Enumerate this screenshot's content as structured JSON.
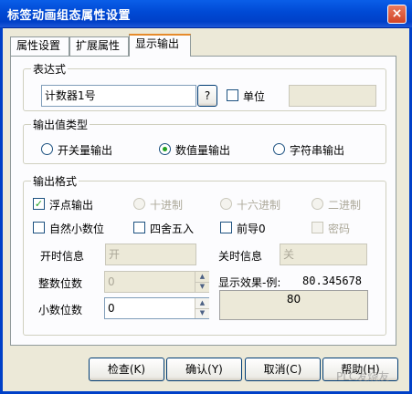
{
  "window": {
    "title": "标签动画组态属性设置",
    "close_label": "×"
  },
  "tabs": [
    {
      "label": "属性设置",
      "active": false
    },
    {
      "label": "扩展属性",
      "active": false
    },
    {
      "label": "显示输出",
      "active": true
    }
  ],
  "expression": {
    "group_label": "表达式",
    "value": "计数器1号",
    "help_button": "?",
    "unit_label": "单位",
    "unit_checked": false,
    "unit_value": ""
  },
  "output_type": {
    "group_label": "输出值类型",
    "options": [
      "开关量输出",
      "数值量输出",
      "字符串输出"
    ],
    "selected": "数值量输出"
  },
  "output_format": {
    "group_label": "输出格式",
    "float_output": {
      "label": "浮点输出",
      "checked": true
    },
    "decimal": {
      "label": "十进制"
    },
    "hex": {
      "label": "十六进制"
    },
    "binary": {
      "label": "二进制"
    },
    "natural_decimal": {
      "label": "自然小数位",
      "checked": false
    },
    "round": {
      "label": "四舍五入",
      "checked": false
    },
    "leading_zero": {
      "label": "前导0",
      "checked": false
    },
    "password": {
      "label": "密码",
      "checked": false
    },
    "on_info_label": "开时信息",
    "on_info_value": "开",
    "off_info_label": "关时信息",
    "off_info_value": "关",
    "integer_digits_label": "整数位数",
    "integer_digits_value": "0",
    "decimal_digits_label": "小数位数",
    "decimal_digits_value": "0",
    "preview_label": "显示效果-例:",
    "preview_example": "80.345678",
    "preview_result": "80"
  },
  "buttons": {
    "check": "检查(K)",
    "confirm": "确认(Y)",
    "cancel": "取消(C)",
    "help": "帮助(H)"
  },
  "watermark": "PLC发烧友"
}
